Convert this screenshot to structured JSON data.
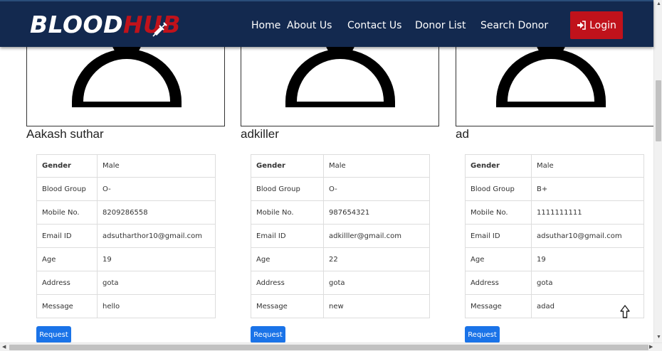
{
  "brand": {
    "part1": "BLOOD",
    "part2": "HUB",
    "icon": "syringe-icon"
  },
  "nav": {
    "home": "Home",
    "about": "About Us",
    "contact": "Contact Us",
    "donor_list": "Donor List",
    "search_donor": "Search Donor",
    "login": "Login",
    "login_icon": "sign-in-icon"
  },
  "colors": {
    "navbar": "#13294f",
    "accent_red": "#c0121b",
    "button_blue": "#1a73e8"
  },
  "labels": {
    "gender": "Gender",
    "blood_group": "Blood Group",
    "mobile": "Mobile No.",
    "email": "Email ID",
    "age": "Age",
    "address": "Address",
    "message": "Message",
    "request": "Request"
  },
  "donors": [
    {
      "name": "Aakash suthar",
      "gender": "Male",
      "blood_group": "O-",
      "mobile": "8209286558",
      "email": "adsutharthor10@gmail.com",
      "age": "19",
      "address": "gota",
      "message": "hello"
    },
    {
      "name": "adkiller",
      "gender": "Male",
      "blood_group": "O-",
      "mobile": "987654321",
      "email": "adkilller@gmail.com",
      "age": "22",
      "address": "gota",
      "message": "new"
    },
    {
      "name": "ad",
      "gender": "Male",
      "blood_group": "B+",
      "mobile": "1111111111",
      "email": "adsuthar10@gmail.com",
      "age": "19",
      "address": "gota",
      "message": "adad"
    }
  ]
}
